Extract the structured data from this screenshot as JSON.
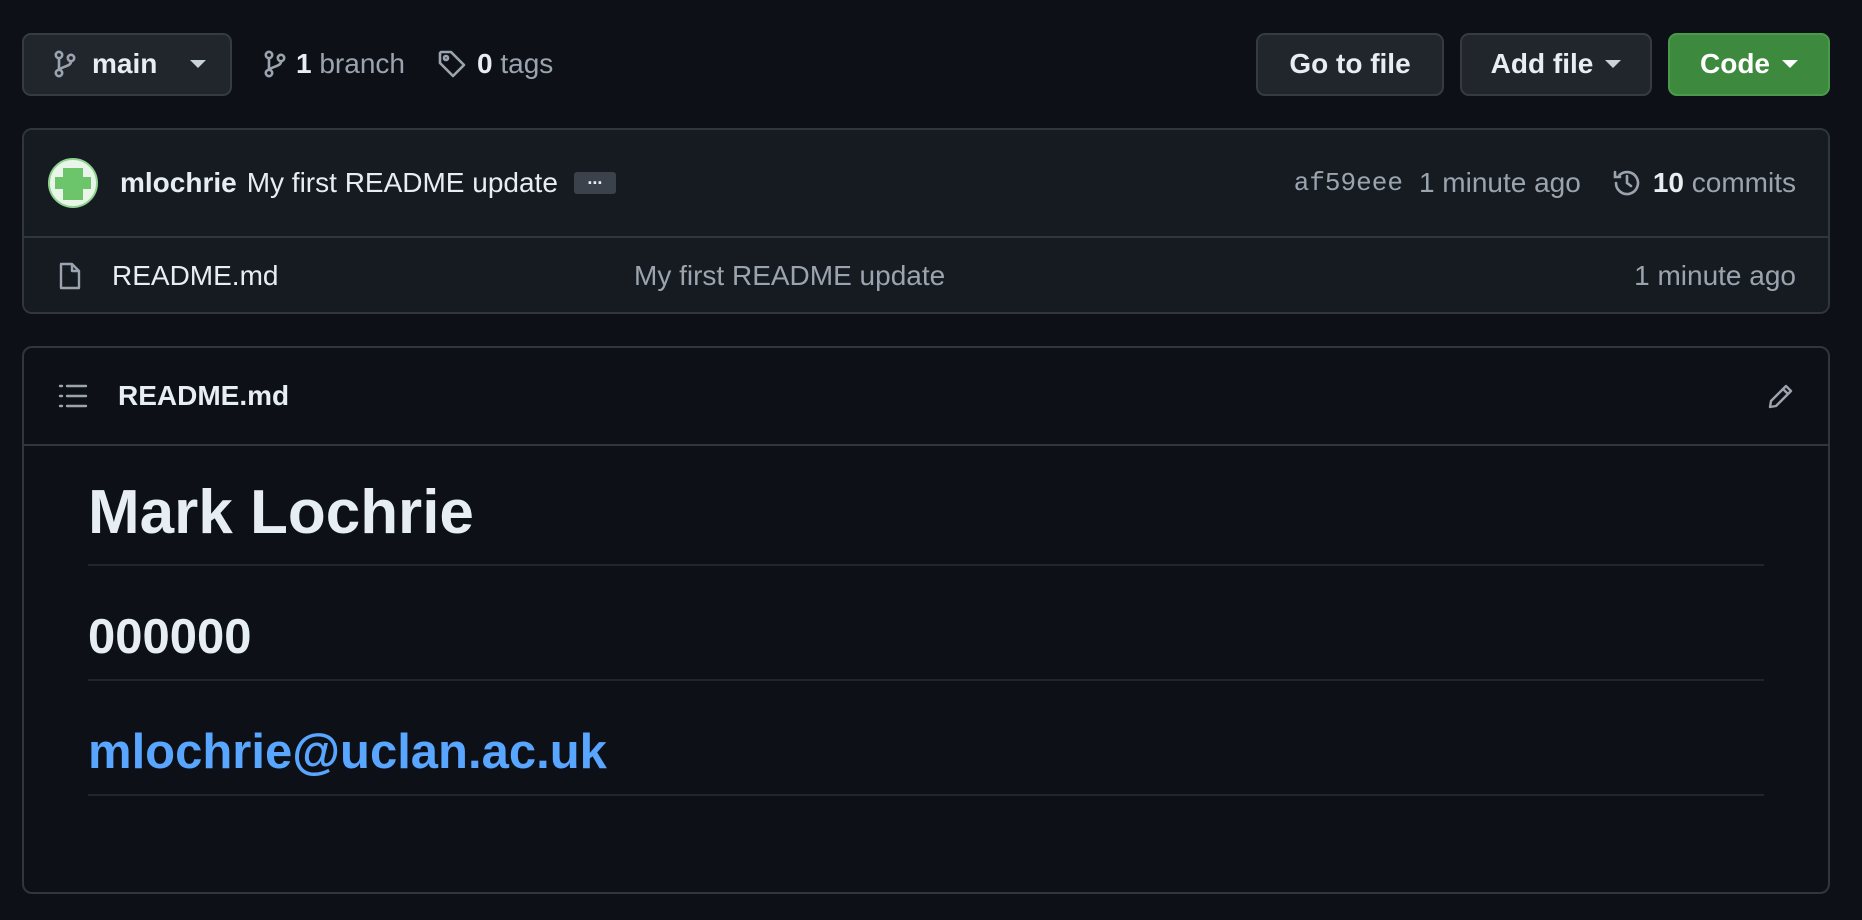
{
  "toolbar": {
    "branch_name": "main",
    "branch_count": "1",
    "branch_label": "branch",
    "tag_count": "0",
    "tag_label": "tags",
    "goto_file_label": "Go to file",
    "add_file_label": "Add file",
    "code_label": "Code"
  },
  "commit": {
    "author": "mlochrie",
    "message": "My first README update",
    "ellipsis": "...",
    "sha": "af59eee",
    "time": "1 minute ago",
    "commit_count": "10",
    "commits_label": "commits"
  },
  "files": [
    {
      "name": "README.md",
      "last_commit": "My first README update",
      "time": "1 minute ago",
      "icon": "file-icon"
    }
  ],
  "readme": {
    "title": "README.md",
    "heading": "Mark Lochrie",
    "subheading": "000000",
    "email": "mlochrie@uclan.ac.uk"
  },
  "colors": {
    "background": "#0d1117",
    "panel": "#161b22",
    "border": "#30363d",
    "accent_green": "#3d8a3f",
    "link_blue": "#58a6ff",
    "muted_text": "#9ba4ae"
  }
}
